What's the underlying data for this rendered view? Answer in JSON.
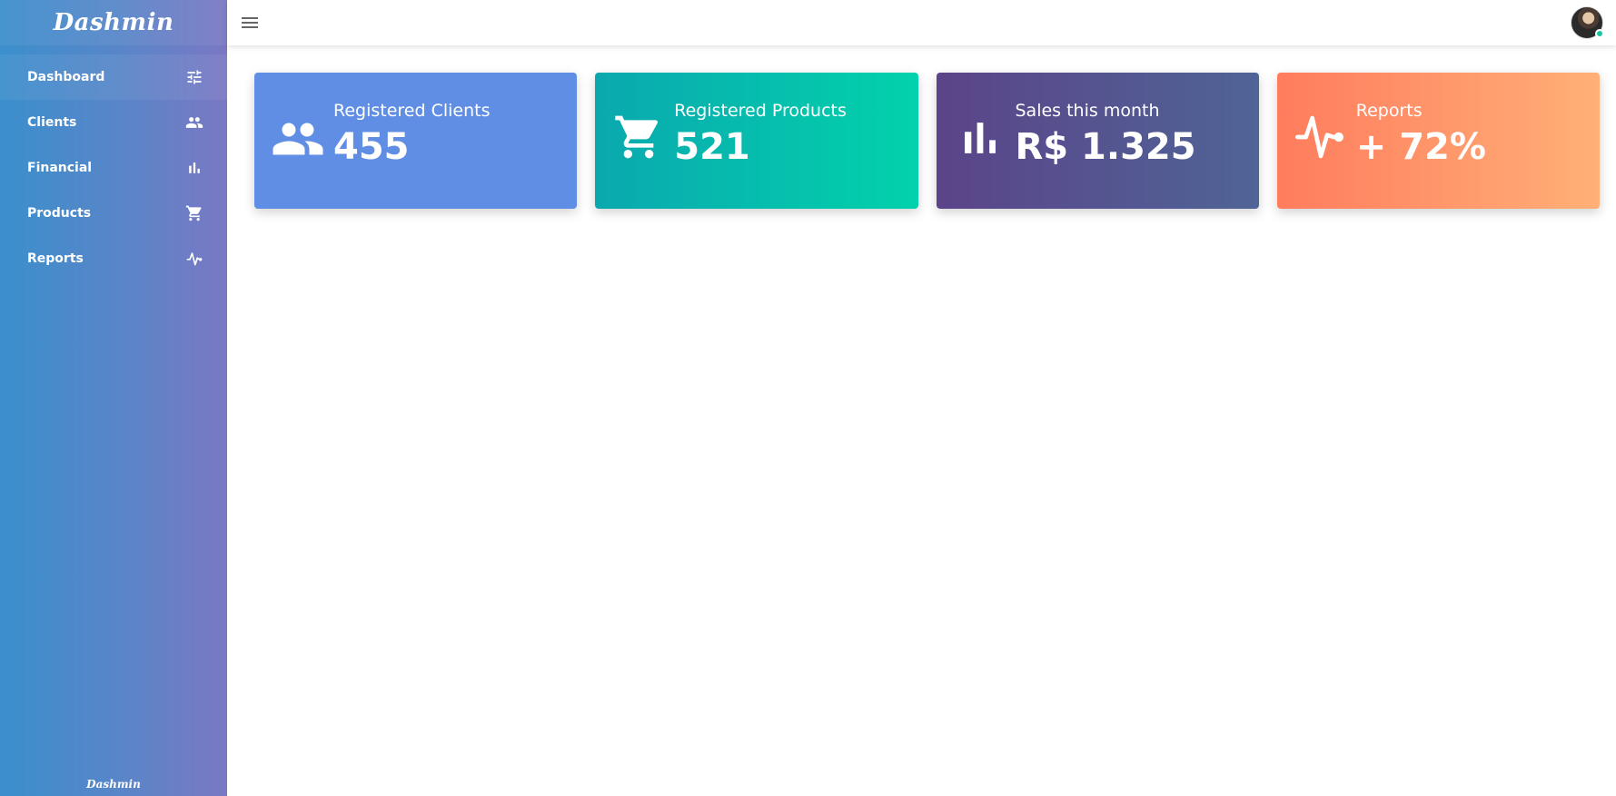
{
  "brand": {
    "title": "Dashmin",
    "footer": "Dashmin"
  },
  "sidebar": {
    "items": [
      {
        "label": "Dashboard",
        "icon": "sliders-icon"
      },
      {
        "label": "Clients",
        "icon": "people-icon"
      },
      {
        "label": "Financial",
        "icon": "bar-chart-icon"
      },
      {
        "label": "Products",
        "icon": "cart-icon"
      },
      {
        "label": "Reports",
        "icon": "pulse-icon"
      }
    ]
  },
  "topbar": {
    "menu_icon": "hamburger-icon",
    "avatar": "user-avatar",
    "status_color": "#19c6a1"
  },
  "cards": [
    {
      "title": "Registered Clients",
      "value": "455",
      "icon": "people-icon",
      "color": "#5f8ee4"
    },
    {
      "title": "Registered Products",
      "value": "521",
      "icon": "cart-icon",
      "color": "#02d2ac"
    },
    {
      "title": "Sales this month",
      "value": "R$ 1.325",
      "icon": "bar-chart-icon",
      "color": "#5b4489"
    },
    {
      "title": "Reports",
      "value": "+ 72%",
      "icon": "pulse-icon",
      "color": "#ff7c5d"
    }
  ]
}
